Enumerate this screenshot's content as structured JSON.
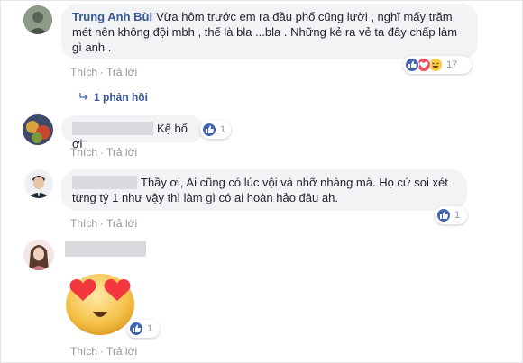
{
  "comments": [
    {
      "author": "Trung Anh Bùi",
      "text": "Vừa hôm trước em ra đầu phố cũng lười , nghĩ mấy trăm mét nên không đội mbh , thế là bla ...bla . Những kẻ ra vẻ ta đây chấp làm gì anh .",
      "actions": {
        "like": "Thích",
        "reply": "Trả lời",
        "separator": "·"
      },
      "reactions": {
        "count": "17",
        "icons": [
          "like-icon",
          "love-icon",
          "haha-icon"
        ]
      },
      "replies_label": "1 phản hồi"
    },
    {
      "author": "",
      "text": "Kệ bố ơi",
      "actions": {
        "like": "Thích",
        "reply": "Trả lời",
        "separator": "·"
      },
      "reactions": {
        "count": "1",
        "icons": [
          "like-icon"
        ]
      }
    },
    {
      "author": "",
      "text_line1": "Thầy ơi, Ai cũng có lúc vội và nhỡ nhàng mà. Họ cứ soi xét",
      "text_line2": "từng tý 1 như vậy thì làm gì có ai hoàn hảo đâu ah.",
      "actions": {
        "like": "Thích",
        "reply": "Trả lời",
        "separator": "·"
      },
      "reactions": {
        "count": "1",
        "icons": [
          "like-icon"
        ]
      }
    },
    {
      "author": "",
      "sticker": "heart-eyes-emoji-sticker",
      "actions": {
        "like": "Thích",
        "reply": "Trả lời",
        "separator": "·"
      },
      "reactions": {
        "count": "1",
        "icons": [
          "like-icon"
        ]
      }
    }
  ],
  "colors": {
    "link": "#385898",
    "like_blue": "#4267b2",
    "love_red": "#f25268",
    "haha_yellow": "#f7c944",
    "meta_gray": "#90949c",
    "bubble": "#f2f3f5"
  }
}
